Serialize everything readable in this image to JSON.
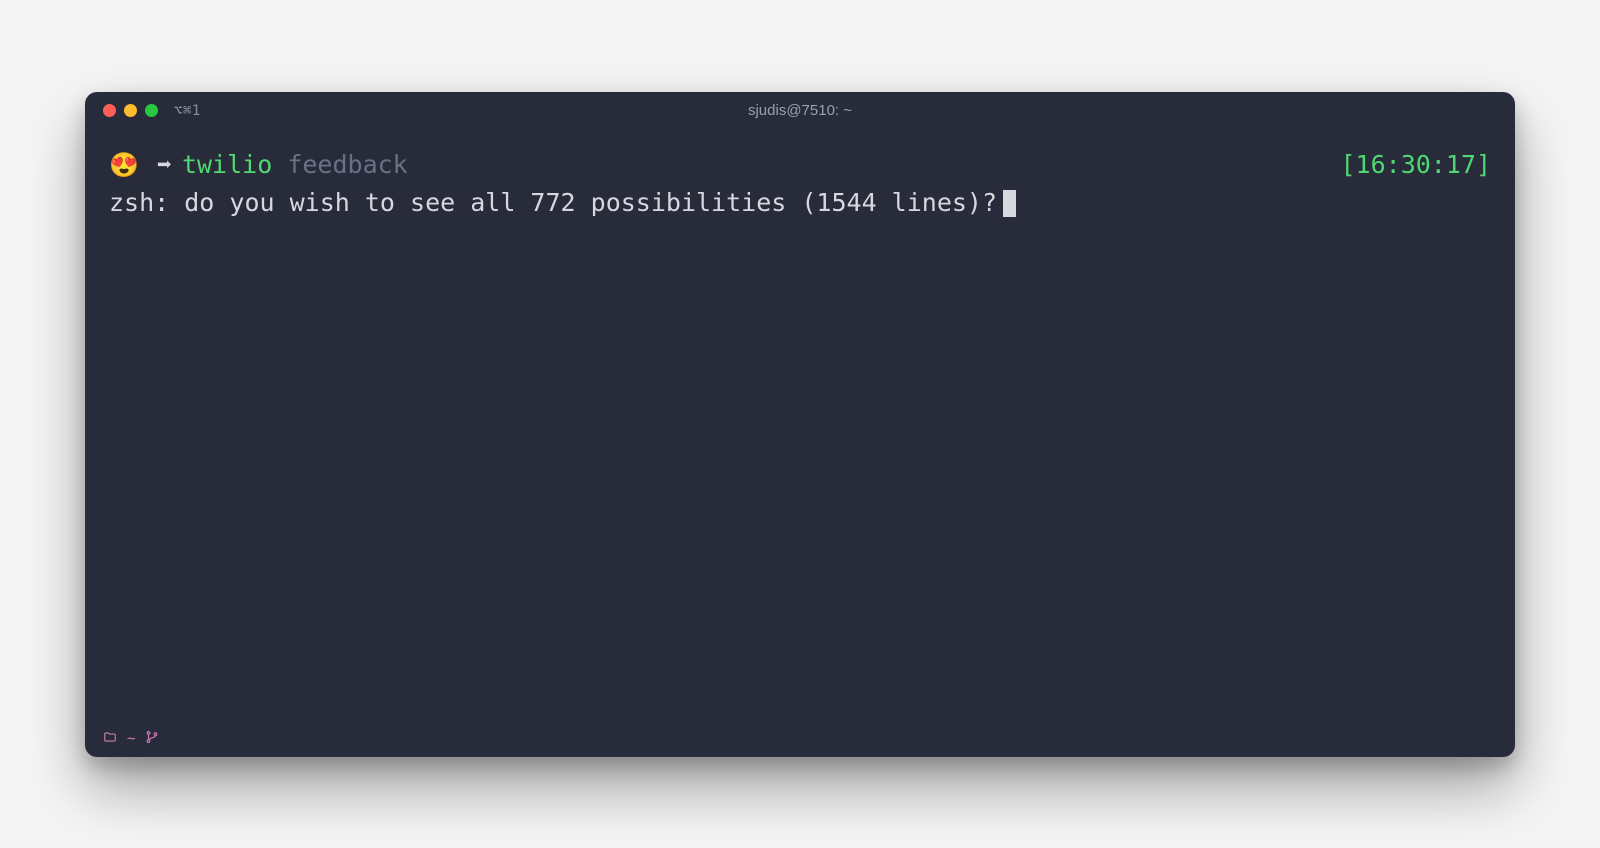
{
  "window": {
    "title": "sjudis@7510: ~",
    "tab_indicator": "⌥⌘1"
  },
  "prompt": {
    "emoji": "😍",
    "arrow": "➡",
    "command": "twilio",
    "suggestion": " feedback",
    "timestamp": "[16:30:17]"
  },
  "output": {
    "line1": "zsh: do you wish to see all 772 possibilities (1544 lines)?"
  },
  "status": {
    "path": "~"
  },
  "colors": {
    "bg": "#282c3a",
    "green": "#4fd870",
    "muted": "#6a7186",
    "text": "#d5d8df",
    "pink": "#c97db3"
  }
}
